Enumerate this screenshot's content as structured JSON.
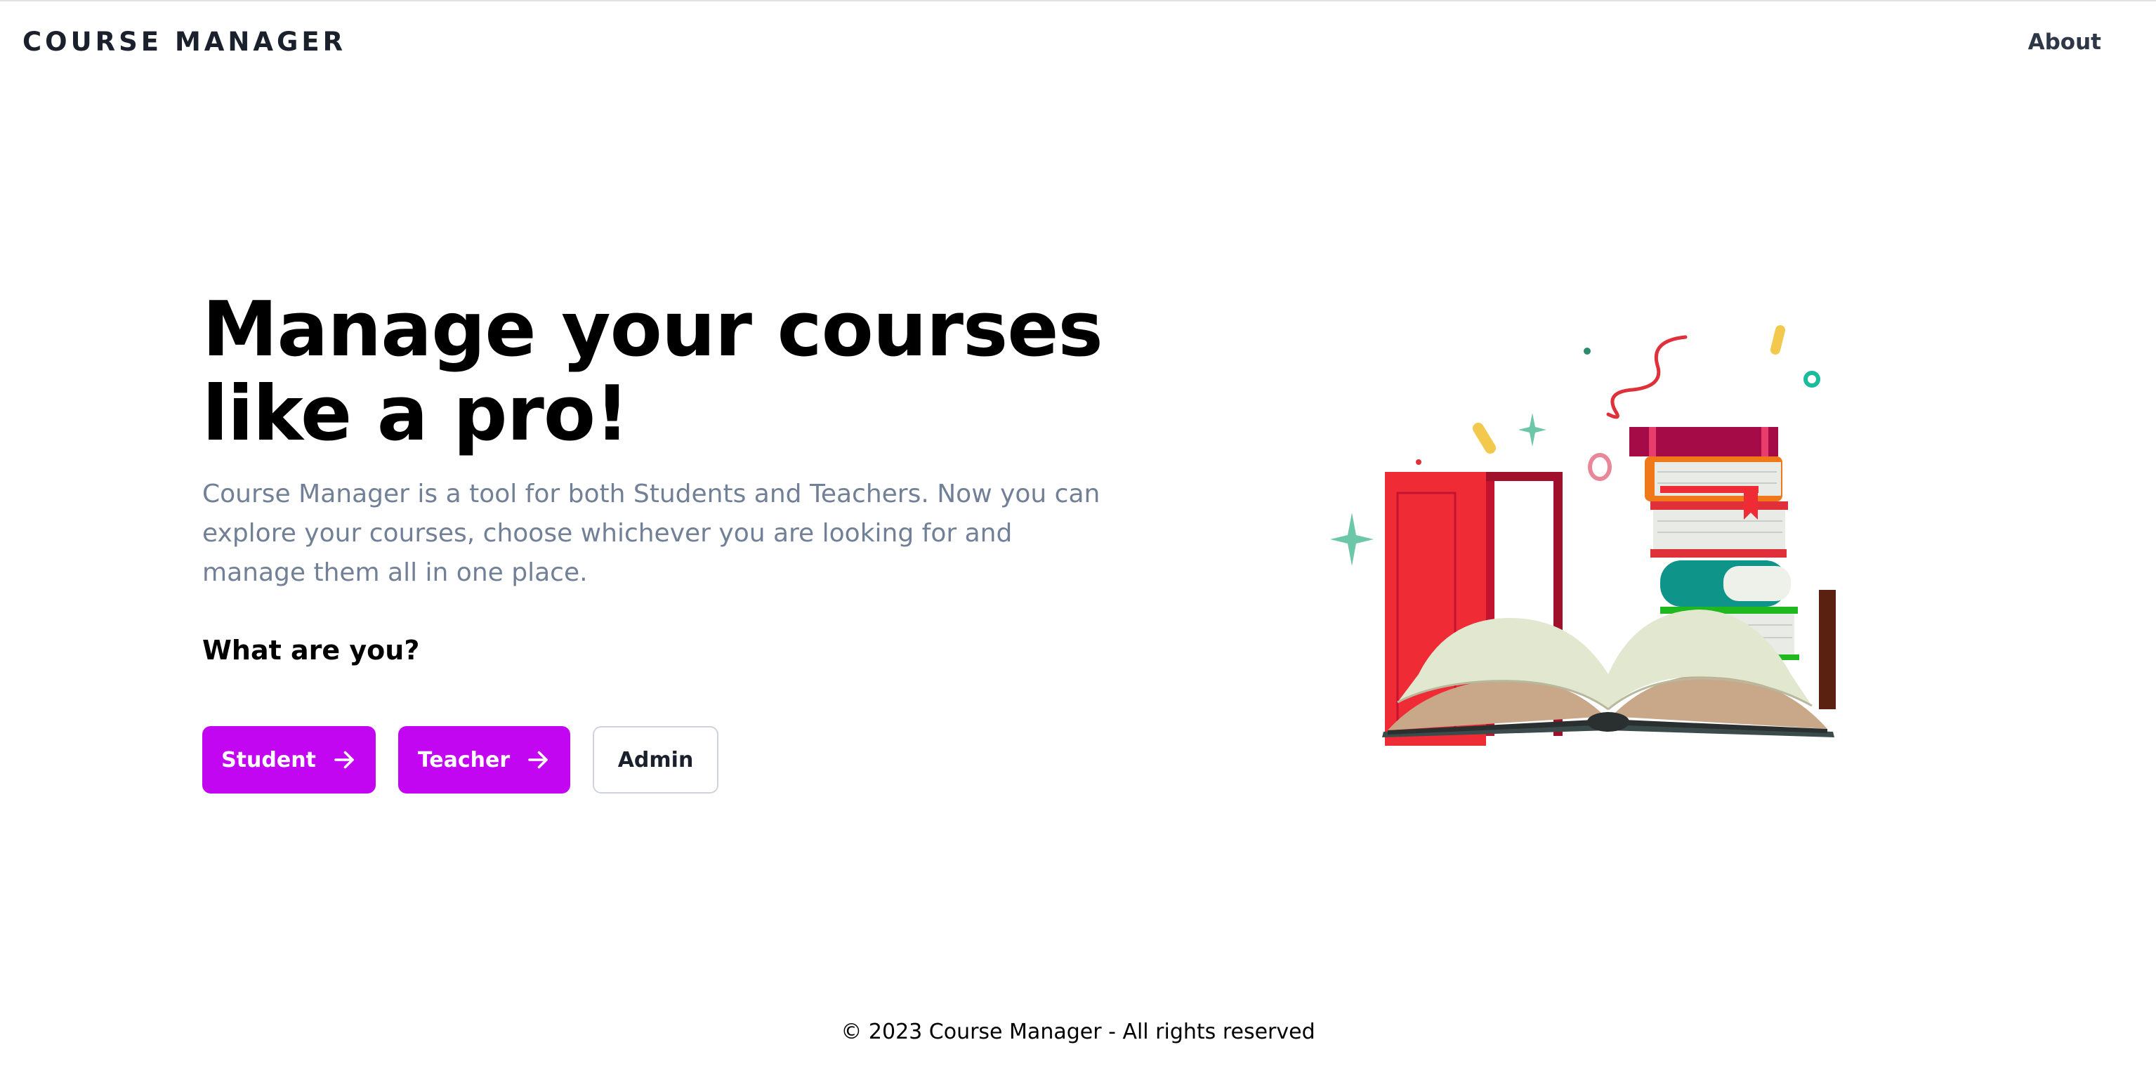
{
  "nav": {
    "brand": "COURSE MANAGER",
    "about": "About"
  },
  "hero": {
    "title": "Manage your courses like a pro!",
    "description": "Course Manager is a tool for both Students and Teachers. Now you can explore your courses, choose whichever you are looking for and manage them all in one place.",
    "question": "What are you?",
    "buttons": {
      "student": "Student",
      "teacher": "Teacher",
      "admin": "Admin"
    },
    "button_icon": "arrow-right-icon"
  },
  "illustration": {
    "icon": "books-illustration"
  },
  "footer": {
    "text": "© 2023 Course Manager - All rights reserved"
  },
  "colors": {
    "accent": "#c206f2",
    "text_dark": "#1a202c",
    "text_muted": "#718096"
  }
}
